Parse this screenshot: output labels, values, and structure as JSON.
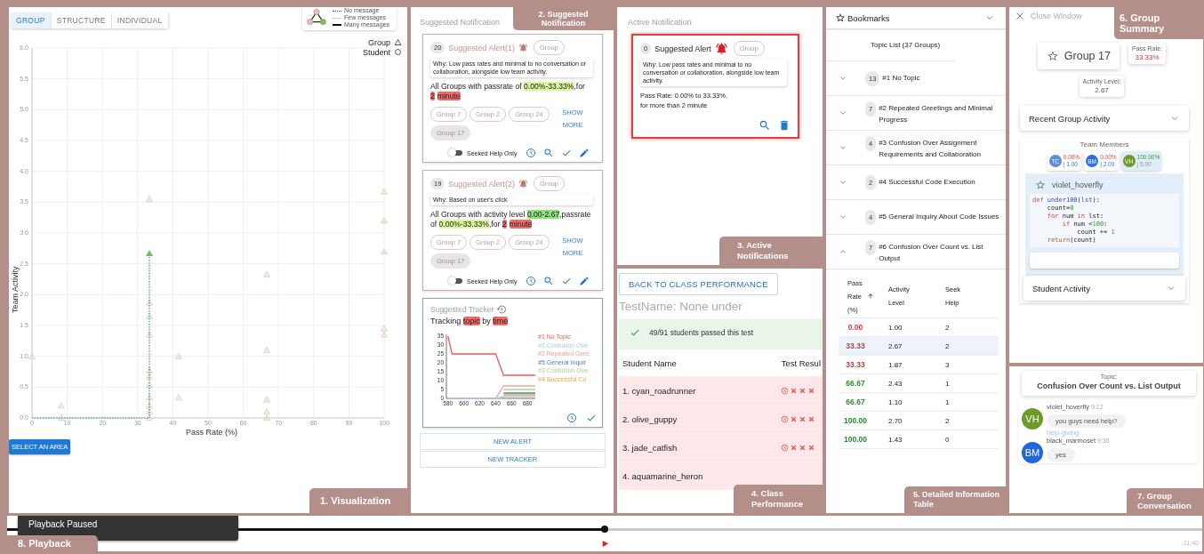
{
  "visualization": {
    "tag": "1. Visualization",
    "tabs": [
      {
        "label": "GROUP",
        "selected": true
      },
      {
        "label": "STRUCTURE",
        "selected": false
      },
      {
        "label": "INDIVIDUAL",
        "selected": false
      }
    ],
    "legend": {
      "edges": [
        {
          "label": "No message",
          "kind": "dotted"
        },
        {
          "label": "Few messages",
          "kind": "thin"
        },
        {
          "label": "Many messages",
          "kind": "thick"
        }
      ],
      "shapes": [
        {
          "kind": "triangle"
        },
        {
          "label": "Student",
          "kind": "circle"
        }
      ]
    },
    "chart_data": {
      "type": "scatter",
      "grid": true,
      "ref_lines": [
        {
          "axis": "x",
          "value": 33.33
        },
        {
          "axis": "y",
          "value": 0
        }
      ],
      "xlabel": "Pass Rate (%)",
      "ylabel": "Team Activity",
      "xlim": [
        0,
        100
      ],
      "ylim": [
        0,
        6
      ],
      "xticks": [
        0,
        10,
        20,
        30,
        40,
        50,
        60,
        70,
        80,
        90,
        100
      ],
      "yticks": [
        {
          "value": 0,
          "label": "0.0"
        },
        {
          "value": 0.5,
          "label": "0.5"
        },
        {
          "value": 1,
          "label": "1.0"
        },
        {
          "value": 1.5,
          "label": "1.5"
        },
        {
          "value": 2,
          "label": "2.0"
        },
        {
          "value": 2.5,
          "label": "2.5"
        },
        {
          "value": 3,
          "label": "3.0"
        },
        {
          "value": 3.5,
          "label": "3.5"
        },
        {
          "value": 4,
          "label": "4.0"
        },
        {
          "value": 4.5,
          "label": "4.5"
        },
        {
          "value": 5,
          "label": "5.0"
        },
        {
          "value": 5.5,
          "label": "5.5"
        },
        {
          "value": 6,
          "label": "6.0"
        }
      ],
      "x": [
        33.33,
        100,
        100,
        100,
        66.67,
        33.33,
        33.33,
        33.33,
        100,
        100,
        0,
        41.67,
        66.67,
        33.33,
        33.33,
        33.33,
        33.33,
        41.67,
        66.67,
        8.33,
        33.33,
        33.33,
        66.67,
        8.33,
        33.33,
        66.67,
        33.33
      ],
      "series": [
        {
          "name": "Group",
          "color": "#e3d9c6",
          "values": [
            3.55,
            3.67,
            3.2,
            2.7,
            2.33,
            1.87,
            1.65,
            1.35,
            1.45,
            1.35,
            1.0,
            1.0,
            1.1,
            0.77,
            0.67,
            0.53,
            0.33,
            0.33,
            0.3,
            0.2,
            0.2,
            0.1,
            0.1,
            0,
            0,
            0,
            null
          ]
        },
        {
          "color": "#7cb66a",
          "values": [
            null,
            null,
            null,
            null,
            null,
            null,
            null,
            null,
            null,
            null,
            null,
            null,
            null,
            null,
            null,
            null,
            null,
            null,
            null,
            null,
            null,
            null,
            null,
            null,
            null,
            null,
            2.67
          ]
        }
      ]
    },
    "select_button": "SELECT AN AREA"
  },
  "suggested": {
    "title": "Suggested Notification",
    "tag": "2. Suggested Notification",
    "alerts": [
      {
        "count": "20",
        "title": "Suggested Alert(1)",
        "scope": "Group",
        "why": "Why: Low pass rates and minimal to no conversation or collaboration, alongside low team activity.",
        "rule": [
          {
            "text": "All Groups with passrate of ",
            "kind": "plain"
          },
          {
            "text": "0.00%-33.33%",
            "kind": "pass"
          },
          {
            "text": ",for ",
            "kind": "plain"
          },
          {
            "text": "2",
            "kind": "time"
          },
          {
            "text": "minute",
            "kind": "time"
          }
        ],
        "groups": [
          {
            "label": "Group 7",
            "selected": false
          },
          {
            "label": "Group 2",
            "selected": false
          },
          {
            "label": "Group 24",
            "selected": false
          },
          {
            "label": "Group 17",
            "selected": true
          }
        ],
        "more": "SHOW MORE",
        "toggle": {
          "label": "Seeked Help Only",
          "on": false
        }
      },
      {
        "count": "19",
        "title": "Suggested Alert(2)",
        "scope": "Group",
        "why": "Why: Based on user's click",
        "rule": [
          {
            "text": "All Groups with activity level ",
            "kind": "plain"
          },
          {
            "text": "0.00-2.67",
            "kind": "activity"
          },
          {
            "text": ",passrate of ",
            "kind": "plain"
          },
          {
            "text": "0.00%-33.33%",
            "kind": "pass"
          },
          {
            "text": ",for ",
            "kind": "plain"
          },
          {
            "text": "2",
            "kind": "time"
          },
          {
            "text": "minute",
            "kind": "time"
          }
        ],
        "groups": [
          {
            "label": "Group 7",
            "selected": false
          },
          {
            "label": "Group 2",
            "selected": false
          },
          {
            "label": "Group 24",
            "selected": false
          },
          {
            "label": "Group 17",
            "selected": true
          }
        ],
        "more": "SHOW MORE",
        "toggle": {
          "label": "Seeked Help Only",
          "on": false
        }
      }
    ],
    "tracker": {
      "title": "Suggested Tracker",
      "text": [
        {
          "text": "Tracking ",
          "kind": "plain"
        },
        {
          "text": "topic",
          "kind": "time"
        },
        {
          "text": " by ",
          "kind": "plain"
        },
        {
          "text": "time",
          "kind": "time"
        }
      ],
      "chart_data": {
        "type": "line",
        "x": [
          580,
          585,
          640,
          650,
          690
        ],
        "xlim": [
          578,
          690
        ],
        "ylim": [
          0,
          36
        ],
        "xticks": [
          580,
          600,
          620,
          640,
          660,
          680
        ],
        "yticks": [
          0,
          5,
          10,
          15,
          20,
          25,
          30,
          35
        ],
        "series": [
          {
            "name": "#1 No Topic",
            "color": "#f05a5a",
            "values": [
              35,
              25,
              25,
              13,
              13
            ]
          },
          {
            "name": "#6 Confusion Ove",
            "color": "#a8cce8",
            "values": [
              0,
              0,
              0,
              1,
              1
            ]
          },
          {
            "name": "#2 Repeated Gree",
            "color": "#f5a0a0",
            "values": [
              0,
              0,
              0,
              7,
              7
            ]
          },
          {
            "name": "#5 General Inquir",
            "color": "#4a7fb8",
            "values": [
              null,
              null,
              null,
              3,
              3
            ]
          },
          {
            "name": "#3 Confusion Ove",
            "color": "#a5d98a",
            "values": [
              null,
              null,
              null,
              5,
              5
            ]
          },
          {
            "name": "#4 Successful Co",
            "color": "#f5a040",
            "values": [
              null,
              null,
              null,
              2,
              2
            ]
          }
        ]
      }
    },
    "buttons": [
      "NEW ALERT",
      "NEW TRACKER"
    ]
  },
  "active": {
    "title": "Active Notification",
    "tag": "3. Active Notifications",
    "alert": {
      "count": "0",
      "title": "Suggested Alert",
      "scope": "Group",
      "why": "Why: Low pass rates and minimal to no conversation or collaboration, alongside low team activity.",
      "lines": [
        "Pass Rate: 0.00% to 33.33%,",
        "for more than 2 minute"
      ]
    }
  },
  "class_performance": {
    "tag": "4. Class Performance",
    "back_button": "BACK TO CLASS PERFORMANCE",
    "test_name": "TestName: None under",
    "banner": "49/91 students passed this test",
    "columns": [
      "Student Name",
      "Test Resul"
    ],
    "rows": [
      {
        "name": "1. cyan_roadrunner",
        "passed": false,
        "results": [
          {
            "kind": "circled"
          },
          {
            "kind": "plain"
          },
          {
            "kind": "plain"
          },
          {
            "kind": "plain"
          }
        ]
      },
      {
        "name": "2. olive_guppy",
        "passed": false,
        "results": [
          {
            "kind": "circled"
          },
          {
            "kind": "plain"
          },
          {
            "kind": "plain"
          },
          {
            "kind": "plain"
          }
        ]
      },
      {
        "name": "3. jade_catfish",
        "passed": false,
        "results": [
          {
            "kind": "circled"
          },
          {
            "kind": "plain"
          },
          {
            "kind": "plain"
          },
          {
            "kind": "plain"
          }
        ]
      },
      {
        "name": "4. aquamarine_heron",
        "passed": false
      }
    ]
  },
  "details": {
    "tag": "5. Detailed Information Table",
    "bookmarks": "Bookmarks",
    "topic_list": "Topic List (37 Groups)",
    "topics": [
      {
        "count": "13",
        "title": "#1 No Topic",
        "expanded": false
      },
      {
        "count": "7",
        "title": "#2 Repeated Greetings and Minimal Progress",
        "expanded": false
      },
      {
        "count": "4",
        "title": "#3 Confusion Over Assignment Requirements and Collaboration",
        "expanded": false
      },
      {
        "count": "2",
        "title": "#4 Successful Code Execution",
        "expanded": false
      },
      {
        "count": "4",
        "title": "#5 General Inquiry About Code Issues",
        "expanded": false
      },
      {
        "count": "7",
        "title": "#6 Confusion Over Count vs. List Output",
        "expanded": true
      }
    ],
    "table": {
      "columns": [
        "Pass Rate (%)",
        "Activity Level",
        "Seek Help"
      ],
      "rows": [
        {
          "pass": "0.00",
          "color": "#e8312f",
          "activity": "1.00",
          "seek": "2",
          "selected": false
        },
        {
          "pass": "33.33",
          "color": "#b0413d",
          "activity": "2.67",
          "seek": "2",
          "selected": true
        },
        {
          "pass": "33.33",
          "color": "#b0413d",
          "activity": "1.87",
          "seek": "3",
          "selected": false
        },
        {
          "pass": "66.67",
          "color": "#2f8f34",
          "activity": "2.43",
          "seek": "1",
          "selected": false
        },
        {
          "pass": "66.67",
          "color": "#2f8f34",
          "activity": "1.10",
          "seek": "1",
          "selected": false
        },
        {
          "pass": "100.00",
          "color": "#1f8a2a",
          "activity": "2.70",
          "seek": "2",
          "selected": false
        },
        {
          "pass": "100.00",
          "color": "#1f8a2a",
          "activity": "1.43",
          "seek": "0",
          "selected": false
        }
      ]
    }
  },
  "summary": {
    "tag": "6. Group Summary",
    "close": "Close Window",
    "group": "Group 17",
    "pass_label": "Pass Rate:",
    "pass_value": "33.33%",
    "activity_label": "Activity Level:",
    "activity_value": "2.67",
    "recent": {
      "label": "Recent Group Activity",
      "expanded": false
    },
    "team_title": "Team Members",
    "members": [
      {
        "initials": "TC",
        "color": "#5b8fd6",
        "pass": "0.00%",
        "activity": "| 1.00",
        "selected": false
      },
      {
        "initials": "BM",
        "color": "#2f6fe0",
        "pass": "0.00%",
        "activity": "| 2.00",
        "selected": false
      },
      {
        "initials": "VH",
        "color": "#6f9a2a",
        "pass": "100.00%",
        "activity": "| 5.00",
        "selected": true
      }
    ],
    "student": "violet_hoverfly",
    "code": [
      [
        {
          "text": "def",
          "kind": "keyword"
        },
        {
          "text": " under100",
          "kind": "name"
        },
        {
          "text": "(",
          "kind": "plain"
        },
        {
          "text": "lst",
          "kind": "name"
        },
        {
          "text": "):",
          "kind": "plain"
        }
      ],
      [
        {
          "text": "    count=",
          "kind": "plain"
        },
        {
          "text": "0",
          "kind": "number"
        }
      ],
      [
        {
          "text": "    for",
          "kind": "keyword"
        },
        {
          "text": " num ",
          "kind": "plain"
        },
        {
          "text": "in",
          "kind": "keyword"
        },
        {
          "text": " lst:",
          "kind": "plain"
        }
      ],
      [
        {
          "text": "        if",
          "kind": "keyword"
        },
        {
          "text": " num <",
          "kind": "plain"
        },
        {
          "text": "100",
          "kind": "number"
        },
        {
          "text": ":",
          "kind": "plain"
        }
      ],
      [
        {
          "text": "            count += ",
          "kind": "plain"
        },
        {
          "text": "1",
          "kind": "number"
        }
      ],
      [
        {
          "text": "    return",
          "kind": "keyword"
        },
        {
          "text": "(count)",
          "kind": "plain"
        }
      ]
    ],
    "student_activity": {
      "label": "Student Activity",
      "expanded": false
    }
  },
  "conversation": {
    "tag": "7. Group Conversation",
    "topic_label": "Topic:",
    "topic": "Confusion Over Count vs. List Output",
    "messages": [
      {
        "initials": "VH",
        "color": "#6f9a2a",
        "user": "violet_hoverfly",
        "time": "9:12",
        "text": "you guys need help?",
        "label": "help-giving"
      },
      {
        "initials": "BM",
        "color": "#2266dd",
        "user": "black_marmoset",
        "time": "9:36",
        "text": "yes"
      }
    ]
  },
  "playback": {
    "tag": "8. Playback",
    "status": "Playback Paused",
    "level": 0.5,
    "time": "-11:40"
  }
}
